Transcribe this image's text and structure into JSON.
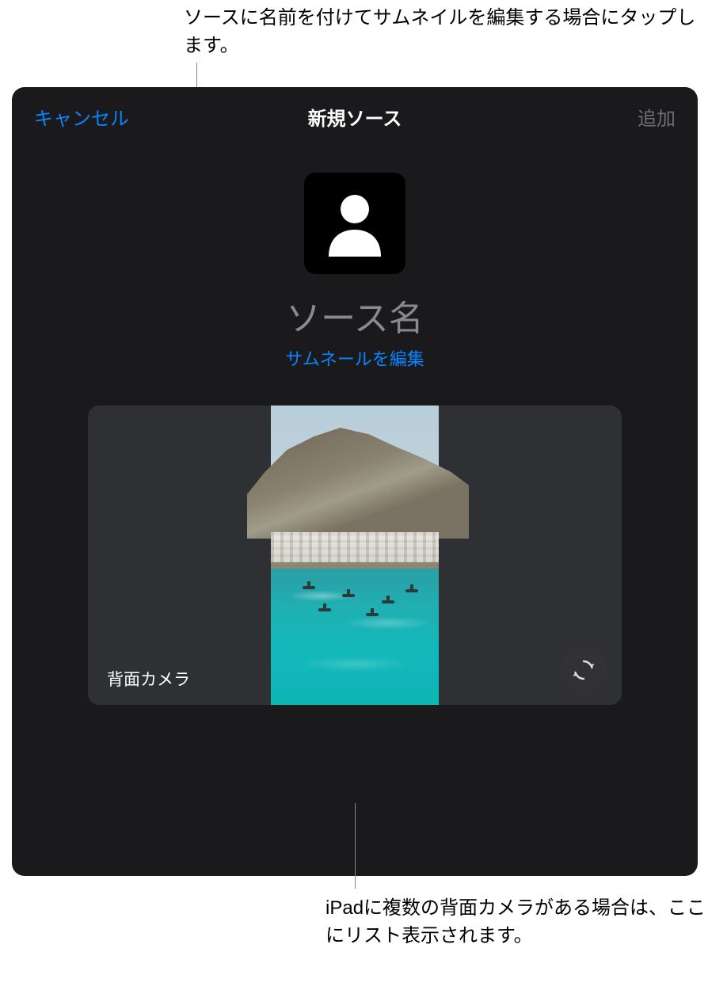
{
  "callouts": {
    "top": "ソースに名前を付けてサムネイルを編集する場合にタップします。",
    "bottom": "iPadに複数の背面カメラがある場合は、ここにリスト表示されます。"
  },
  "navbar": {
    "cancel_label": "キャンセル",
    "title": "新規ソース",
    "add_label": "追加"
  },
  "thumbnail": {
    "icon_name": "person-silhouette-icon",
    "source_name_placeholder": "ソース名",
    "edit_label": "サムネールを編集"
  },
  "preview": {
    "camera_label": "背面カメラ",
    "flip_icon_name": "camera-flip-icon"
  },
  "colors": {
    "accent": "#0a84ff",
    "dialog_bg": "#1a1a1c",
    "panel_bg": "#2f3033",
    "muted_text": "#8a8a8e",
    "disabled_text": "#6e6f74"
  }
}
